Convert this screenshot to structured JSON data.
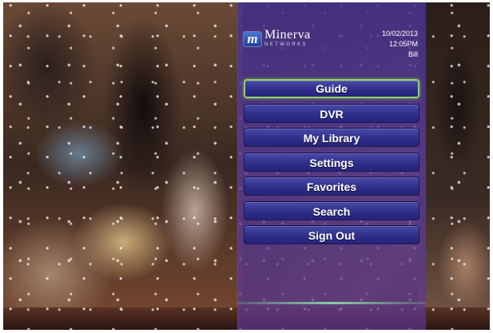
{
  "brand": {
    "logo_mark": "m",
    "name": "Minerva",
    "subtitle": "NETWORKS"
  },
  "status": {
    "date": "10/02/2013",
    "time": "12:05PM",
    "user": "Bill"
  },
  "menu": {
    "selected_index": 0,
    "items": [
      {
        "label": "Guide"
      },
      {
        "label": "DVR"
      },
      {
        "label": "My Library"
      },
      {
        "label": "Settings"
      },
      {
        "label": "Favorites"
      },
      {
        "label": "Search"
      },
      {
        "label": "Sign Out"
      }
    ]
  },
  "colors": {
    "panel": "#4b3792",
    "button": "#2f2f8a",
    "focus": "#8ed45e"
  }
}
